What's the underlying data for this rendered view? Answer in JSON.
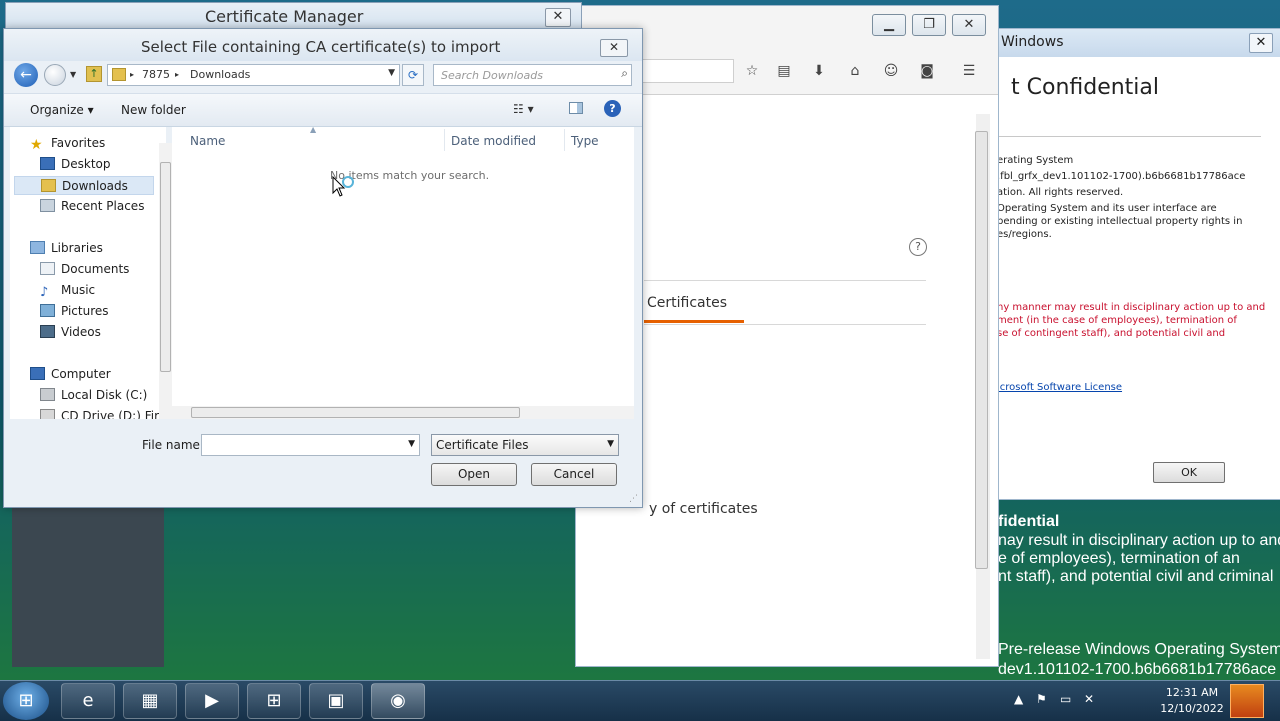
{
  "cert_manager": {
    "title": "Certificate Manager",
    "close": "✕"
  },
  "dialog": {
    "title": "Select File containing CA certificate(s) to import",
    "close": "✕",
    "address": {
      "parts": [
        "7875",
        "Downloads"
      ]
    },
    "search_placeholder": "Search Downloads",
    "toolbar": {
      "organize": "Organize ▾",
      "new_folder": "New folder",
      "help": "?"
    },
    "nav": {
      "favorites": "Favorites",
      "desktop": "Desktop",
      "downloads": "Downloads",
      "recent_places": "Recent Places",
      "libraries": "Libraries",
      "documents": "Documents",
      "music": "Music",
      "pictures": "Pictures",
      "videos": "Videos",
      "computer": "Computer",
      "local_disk": "Local Disk (C:)",
      "cd_drive": "CD Drive (D:) Fire"
    },
    "columns": {
      "name": "Name",
      "date_modified": "Date modified",
      "type": "Type"
    },
    "empty_message": "No items match your search.",
    "file_name_label": "File name:",
    "file_name_value": "",
    "file_type_value": "Certificate Files",
    "open": "Open",
    "cancel": "Cancel"
  },
  "firefox": {
    "tab_certificates": "Certificates",
    "cert_text": "y of certificates",
    "help": "?"
  },
  "about": {
    "title": "Windows",
    "heading": "t Confidential",
    "lines": [
      "erating System",
      ".fbl_grfx_dev1.101102-1700).b6b6681b17786ace",
      "ation.  All rights reserved.",
      " Operating System and its user interface are",
      "pending or existing intellectual property rights in",
      "es/regions."
    ],
    "red_lines": [
      "ny manner may result in disciplinary action up to and",
      "ment (in the case of employees), termination of",
      "se of contingent staff), and potential civil and"
    ],
    "license_link": "icrosoft Software License",
    "ok": "OK"
  },
  "desktop_text": {
    "heading": "fidential",
    "line1": "nay result in disciplinary action up to and",
    "line2": "e of employees), termination of an",
    "line3": "nt staff), and potential civil and criminal",
    "line4": "Pre-release Windows Operating System",
    "line5": "dev1.101102-1700.b6b6681b17786ace"
  },
  "taskbar": {
    "time": "12:31 AM",
    "date": "12/10/2022"
  }
}
